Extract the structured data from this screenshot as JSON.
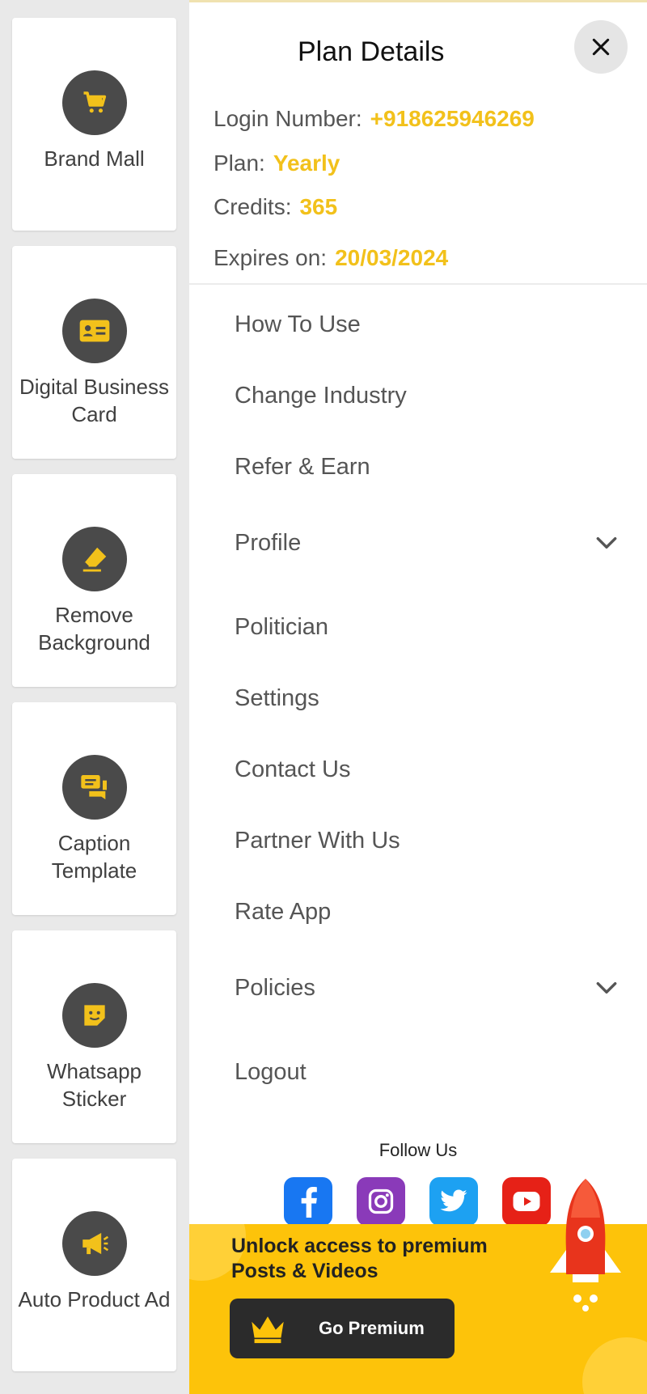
{
  "tools": [
    {
      "name": "brand-mall",
      "label": "Brand Mall",
      "icon": "cart-icon"
    },
    {
      "name": "digital-business-card",
      "label": "Digital Business Card",
      "icon": "id-card-icon"
    },
    {
      "name": "remove-background",
      "label": "Remove Background",
      "icon": "eraser-icon"
    },
    {
      "name": "caption-template",
      "label": "Caption Template",
      "icon": "chat-bubbles-icon"
    },
    {
      "name": "whatsapp-sticker",
      "label": "Whatsapp Sticker",
      "icon": "sticker-icon"
    },
    {
      "name": "auto-product-ad",
      "label": "Auto Product Ad",
      "icon": "megaphone-icon"
    }
  ],
  "plan": {
    "title": "Plan Details",
    "login_label": "Login Number:",
    "login_value": "+918625946269",
    "plan_label": "Plan:",
    "plan_value": "Yearly",
    "credits_label": "Credits:",
    "credits_value": "365",
    "expires_label": "Expires on:",
    "expires_value": "20/03/2024"
  },
  "menu": {
    "how_to_use": "How To Use",
    "change_industry": "Change Industry",
    "refer_earn": "Refer & Earn",
    "profile": "Profile",
    "politician": "Politician",
    "settings": "Settings",
    "contact_us": "Contact Us",
    "partner_with_us": "Partner With Us",
    "rate_app": "Rate App",
    "policies": "Policies",
    "logout": "Logout"
  },
  "follow": {
    "label": "Follow Us",
    "icons": [
      "facebook-icon",
      "instagram-icon",
      "twitter-icon",
      "youtube-icon"
    ]
  },
  "promo": {
    "line1": "Unlock access to premium",
    "line2": "Posts & Videos",
    "button": "Go Premium"
  },
  "colors": {
    "accent": "#f2c11b",
    "promo_bg": "#fdc30a",
    "icon_circle": "#4a4a4a",
    "facebook": "#1877f2",
    "instagram": "#8a3ab9",
    "twitter": "#1da1f2",
    "youtube": "#e62117"
  }
}
